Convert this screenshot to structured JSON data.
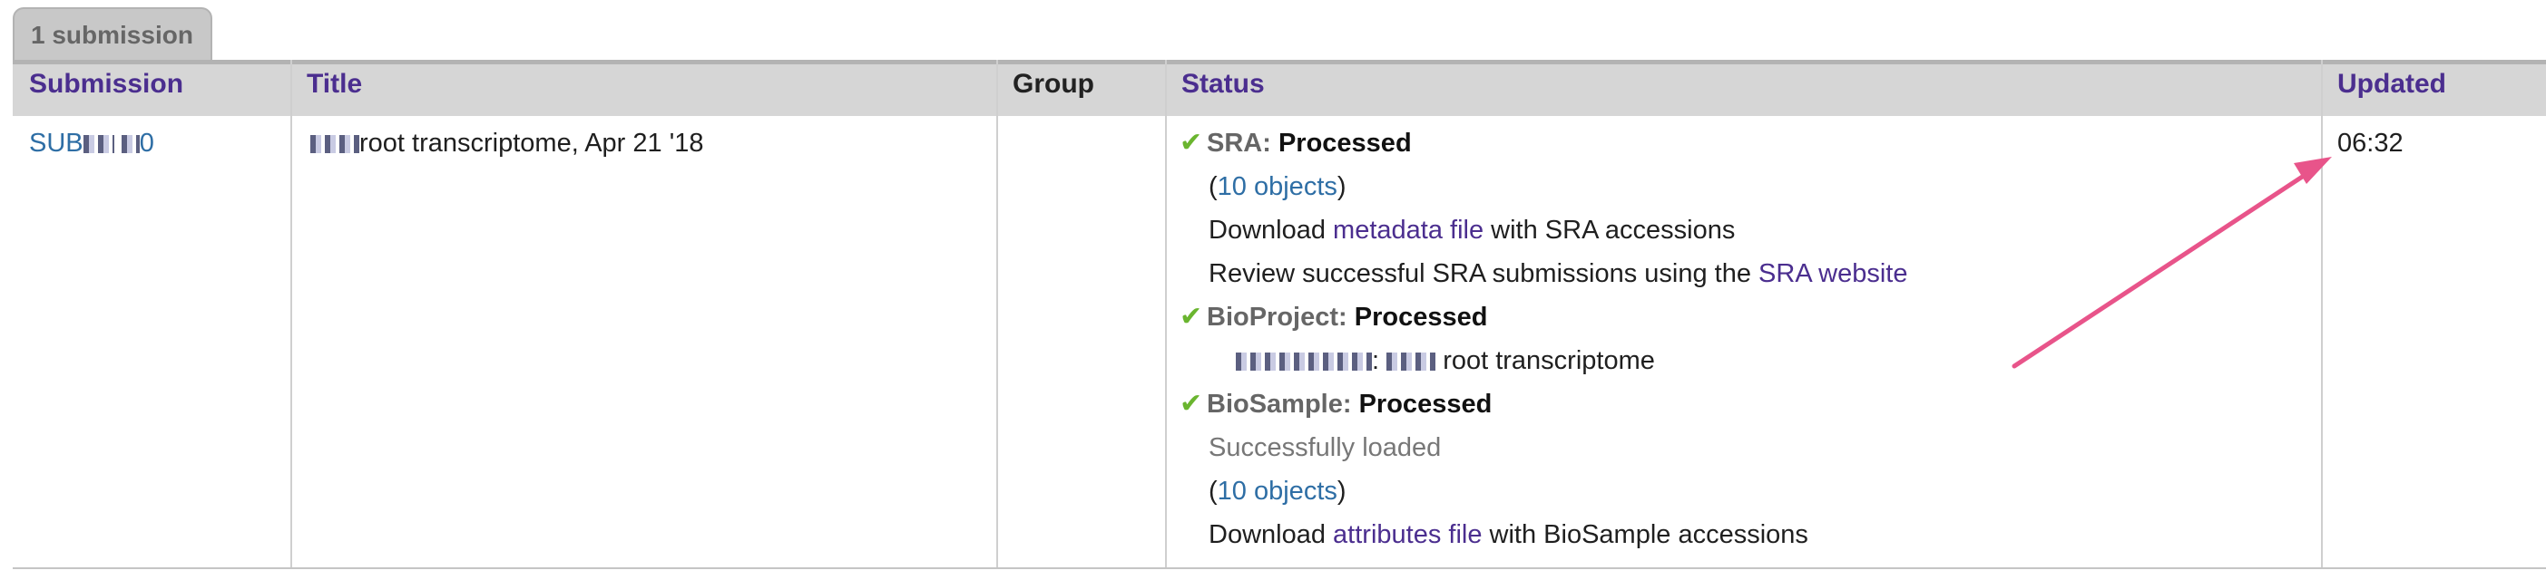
{
  "tab": {
    "label": "1 submission"
  },
  "table": {
    "headers": {
      "submission": "Submission",
      "title": "Title",
      "group": "Group",
      "status": "Status",
      "updated": "Updated"
    },
    "row": {
      "submission_id_prefix": "SUB",
      "submission_id_suffix": "0",
      "title_text": "root transcriptome, Apr 21 '18",
      "updated_time": "06:32",
      "status": {
        "sra": {
          "name": "SRA:",
          "state": "Processed",
          "objects_open": "(",
          "objects_link": "10 objects",
          "objects_close": ")",
          "download_prefix": "Download",
          "download_link": "metadata file",
          "download_suffix": "with SRA accessions",
          "review_prefix": "Review successful SRA submissions using the",
          "review_link": "SRA website"
        },
        "bioproject": {
          "name": "BioProject:",
          "state": "Processed",
          "entry_colon": ":",
          "entry_text": "root transcriptome"
        },
        "biosample": {
          "name": "BioSample:",
          "state": "Processed",
          "loaded_text": "Successfully loaded",
          "objects_open": "(",
          "objects_link": "10 objects",
          "objects_close": ")",
          "download_prefix": "Download",
          "download_link": "attributes file",
          "download_suffix": "with BioSample accessions"
        }
      }
    }
  },
  "colors": {
    "header_text": "#4b2e8f",
    "link": "#2e6ea5",
    "check": "#6ab52f",
    "annotation_arrow": "#e8548a"
  }
}
